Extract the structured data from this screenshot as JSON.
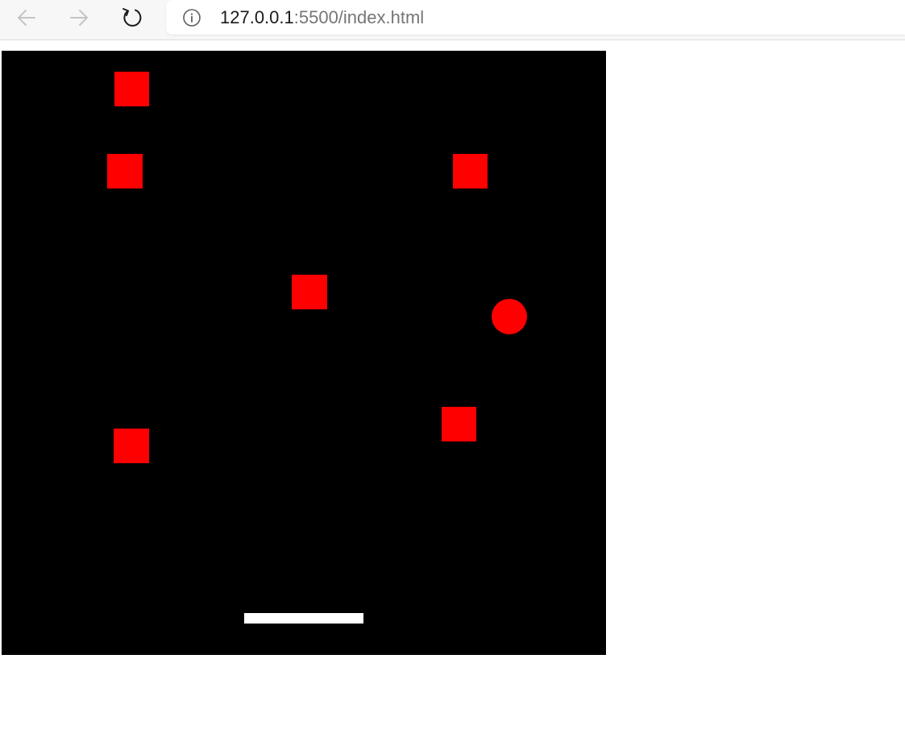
{
  "browser": {
    "url_host": "127.0.0.1",
    "url_rest": ":5500/index.html",
    "icons": {
      "back": "arrow-left-icon",
      "forward": "arrow-right-icon",
      "reload": "reload-icon",
      "site_info": "info-icon"
    }
  },
  "game": {
    "background_color": "#000000",
    "brick_color": "#ff0000",
    "ball_color": "#ff0000",
    "paddle_color": "#ffffff",
    "brick_count": 6
  }
}
